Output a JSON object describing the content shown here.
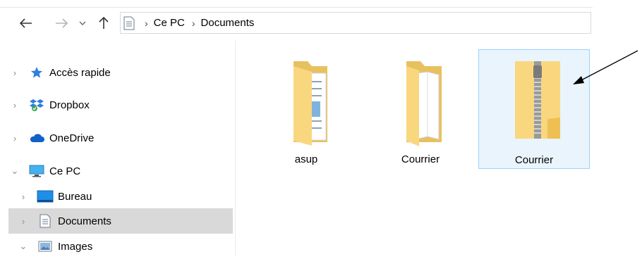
{
  "address": {
    "back_icon": "arrow-left-icon",
    "forward_icon": "arrow-right-icon",
    "recent_icon": "chevron-down-icon",
    "up_icon": "arrow-up-icon",
    "breadcrumbs": [
      "Ce PC",
      "Documents"
    ]
  },
  "sidebar": {
    "items": [
      {
        "label": "Accès rapide",
        "icon": "star-icon"
      },
      {
        "label": "Dropbox",
        "icon": "dropbox-icon"
      },
      {
        "label": "OneDrive",
        "icon": "cloud-icon"
      },
      {
        "label": "Ce PC",
        "icon": "computer-icon"
      },
      {
        "label": "Bureau",
        "icon": "desktop-icon"
      },
      {
        "label": "Documents",
        "icon": "document-icon"
      },
      {
        "label": "Images",
        "icon": "image-icon"
      }
    ]
  },
  "files": [
    {
      "name": "asup",
      "type": "folder-with-documents"
    },
    {
      "name": "Courrier",
      "type": "folder-with-paper"
    },
    {
      "name": "Courrier",
      "type": "zip-folder"
    }
  ],
  "colors": {
    "folder": "#f9d77e",
    "selection_bg": "#eaf4fc",
    "selection_border": "#99d1ff",
    "nav_selected": "#d9d9d9"
  }
}
